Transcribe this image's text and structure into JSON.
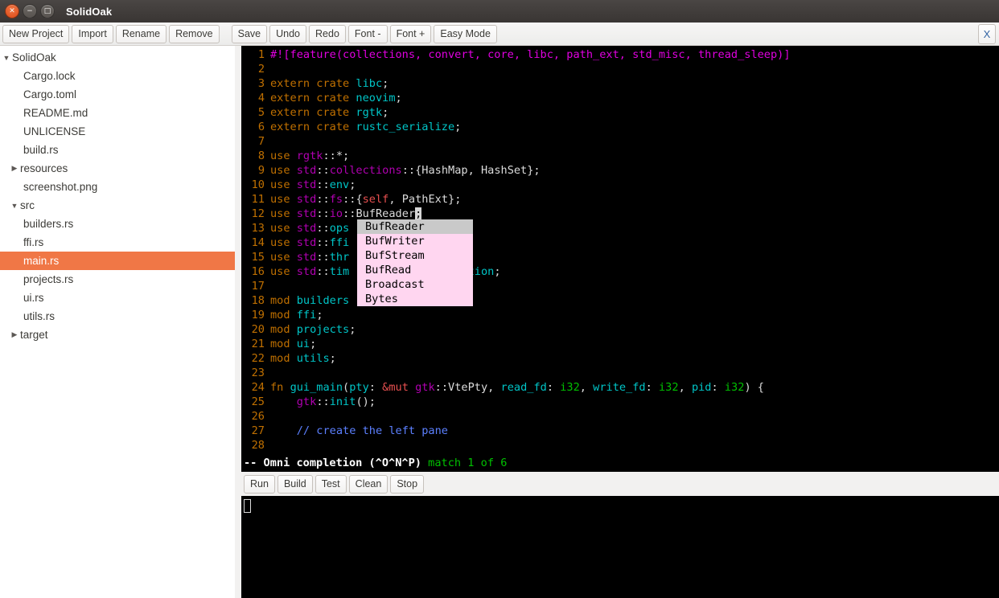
{
  "window": {
    "title": "SolidOak",
    "controls": [
      {
        "name": "close",
        "glyph": "✕"
      },
      {
        "name": "minimize",
        "glyph": "−"
      },
      {
        "name": "maximize",
        "glyph": "□"
      }
    ]
  },
  "toolbar": {
    "buttons": [
      {
        "label": "New Project",
        "name": "new-project-button"
      },
      {
        "label": "Import",
        "name": "import-button"
      },
      {
        "label": "Rename",
        "name": "rename-button"
      },
      {
        "label": "Remove",
        "name": "remove-button"
      },
      {
        "label": "Save",
        "name": "save-button"
      },
      {
        "label": "Undo",
        "name": "undo-button"
      },
      {
        "label": "Redo",
        "name": "redo-button"
      },
      {
        "label": "Font -",
        "name": "font-decrease-button"
      },
      {
        "label": "Font +",
        "name": "font-increase-button"
      },
      {
        "label": "Easy Mode",
        "name": "easy-mode-button"
      }
    ],
    "close_tab_label": "X"
  },
  "sidebar": {
    "items": [
      {
        "label": "SolidOak",
        "level": 0,
        "arrow": "open",
        "selected": false
      },
      {
        "label": "Cargo.lock",
        "level": 1,
        "arrow": "blank",
        "selected": false
      },
      {
        "label": "Cargo.toml",
        "level": 1,
        "arrow": "blank",
        "selected": false
      },
      {
        "label": "README.md",
        "level": 1,
        "arrow": "blank",
        "selected": false
      },
      {
        "label": "UNLICENSE",
        "level": 1,
        "arrow": "blank",
        "selected": false
      },
      {
        "label": "build.rs",
        "level": 1,
        "arrow": "blank",
        "selected": false
      },
      {
        "label": "resources",
        "level": 0,
        "arrow": "closed",
        "selected": false,
        "indent": 12
      },
      {
        "label": "screenshot.png",
        "level": 1,
        "arrow": "blank",
        "selected": false
      },
      {
        "label": "src",
        "level": 0,
        "arrow": "open",
        "selected": false,
        "indent": 12
      },
      {
        "label": "builders.rs",
        "level": 1,
        "arrow": "blank",
        "selected": false,
        "indent": 16
      },
      {
        "label": "ffi.rs",
        "level": 1,
        "arrow": "blank",
        "selected": false,
        "indent": 16
      },
      {
        "label": "main.rs",
        "level": 1,
        "arrow": "blank",
        "selected": true,
        "indent": 16
      },
      {
        "label": "projects.rs",
        "level": 1,
        "arrow": "blank",
        "selected": false,
        "indent": 16
      },
      {
        "label": "ui.rs",
        "level": 1,
        "arrow": "blank",
        "selected": false,
        "indent": 16
      },
      {
        "label": "utils.rs",
        "level": 1,
        "arrow": "blank",
        "selected": false,
        "indent": 16
      },
      {
        "label": "target",
        "level": 0,
        "arrow": "closed",
        "selected": false,
        "indent": 12
      }
    ]
  },
  "editor": {
    "lines": [
      {
        "n": 1,
        "text": "#![feature(collections, convert, core, libc, path_ext, std_misc, thread_sleep)]"
      },
      {
        "n": 2,
        "text": ""
      },
      {
        "n": 3,
        "text": "extern crate libc;"
      },
      {
        "n": 4,
        "text": "extern crate neovim;"
      },
      {
        "n": 5,
        "text": "extern crate rgtk;"
      },
      {
        "n": 6,
        "text": "extern crate rustc_serialize;"
      },
      {
        "n": 7,
        "text": ""
      },
      {
        "n": 8,
        "text": "use rgtk::*;"
      },
      {
        "n": 9,
        "text": "use std::collections::{HashMap, HashSet};"
      },
      {
        "n": 10,
        "text": "use std::env;"
      },
      {
        "n": 11,
        "text": "use std::fs::{self, PathExt};"
      },
      {
        "n": 12,
        "text": "use std::io::BufReader;"
      },
      {
        "n": 13,
        "text": "use std::ops"
      },
      {
        "n": 14,
        "text": "use std::ffi"
      },
      {
        "n": 15,
        "text": "use std::thr"
      },
      {
        "n": 16,
        "text": "use std::tim                 ation;"
      },
      {
        "n": 17,
        "text": ""
      },
      {
        "n": 18,
        "text": "mod builders"
      },
      {
        "n": 19,
        "text": "mod ffi;"
      },
      {
        "n": 20,
        "text": "mod projects;"
      },
      {
        "n": 21,
        "text": "mod ui;"
      },
      {
        "n": 22,
        "text": "mod utils;"
      },
      {
        "n": 23,
        "text": ""
      },
      {
        "n": 24,
        "text": "fn gui_main(pty: &mut gtk::VtePty, read_fd: i32, write_fd: i32, pid: i32) {"
      },
      {
        "n": 25,
        "text": "    gtk::init();"
      },
      {
        "n": 26,
        "text": ""
      },
      {
        "n": 27,
        "text": "    // create the left pane"
      },
      {
        "n": 28,
        "text": ""
      }
    ],
    "completion_popup": {
      "items": [
        "BufReader",
        "BufWriter",
        "BufStream",
        "BufRead",
        "Broadcast",
        "Bytes"
      ],
      "selected_index": 0,
      "background": "#ffd6f0",
      "selected_background": "#c9c9c9"
    },
    "status": {
      "mode": "-- Omni completion (^O^N^P)",
      "match": " match 1 of 6"
    }
  },
  "build_toolbar": {
    "buttons": [
      {
        "label": "Run",
        "name": "run-button"
      },
      {
        "label": "Build",
        "name": "build-button"
      },
      {
        "label": "Test",
        "name": "test-button"
      },
      {
        "label": "Clean",
        "name": "clean-button"
      },
      {
        "label": "Stop",
        "name": "stop-button"
      }
    ]
  },
  "terminal": {
    "content": ""
  },
  "colors": {
    "accent_selection": "#f07746",
    "titlebar": "#393533",
    "editor_background": "#000000",
    "popup_background": "#ffd6f0"
  }
}
